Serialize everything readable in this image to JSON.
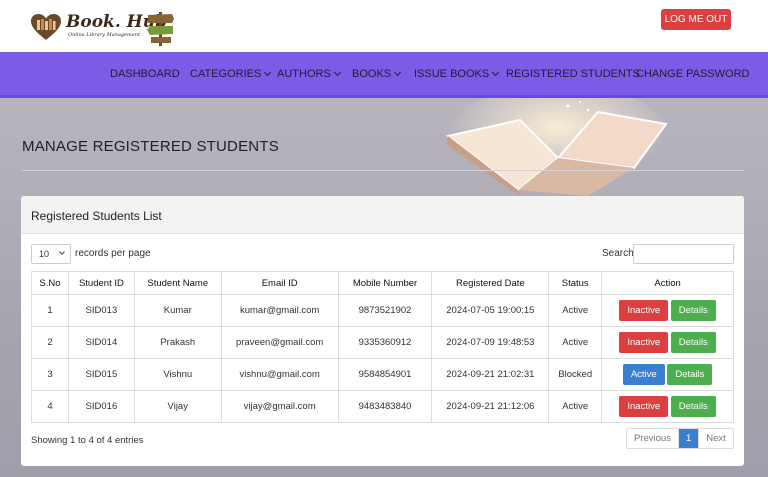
{
  "header": {
    "logo_text": "Book. Hub",
    "logo_subtext": "Online Library Management",
    "logout_label": "LOG ME OUT"
  },
  "nav": [
    {
      "label": "DASHBOARD",
      "dropdown": false
    },
    {
      "label": "CATEGORIES",
      "dropdown": true
    },
    {
      "label": "AUTHORS",
      "dropdown": true
    },
    {
      "label": "BOOKS",
      "dropdown": true
    },
    {
      "label": "ISSUE BOOKS",
      "dropdown": true
    },
    {
      "label": "REGISTERED STUDENTS",
      "dropdown": false
    },
    {
      "label": "CHANGE PASSWORD",
      "dropdown": false
    }
  ],
  "page": {
    "title": "MANAGE REGISTERED STUDENTS"
  },
  "card": {
    "title": "Registered Students List",
    "length_value": "10",
    "length_label": "records per page",
    "search_label": "Search:",
    "search_value": "",
    "columns": [
      "S.No",
      "Student ID",
      "Student Name",
      "Email ID",
      "Mobile Number",
      "Registered Date",
      "Status",
      "Action"
    ],
    "rows": [
      {
        "sno": "1",
        "id": "SID013",
        "name": "Kumar",
        "email": "kumar@gmail.com",
        "mobile": "9873521902",
        "date": "2024-07-05 19:00:15",
        "status": "Active",
        "toggle_label": "Inactive",
        "details_label": "Details"
      },
      {
        "sno": "2",
        "id": "SID014",
        "name": "Prakash",
        "email": "praveen@gmail.com",
        "mobile": "9335360912",
        "date": "2024-07-09 19:48:53",
        "status": "Active",
        "toggle_label": "Inactive",
        "details_label": "Details"
      },
      {
        "sno": "3",
        "id": "SID015",
        "name": "Vishnu",
        "email": "vishnu@gmail.com",
        "mobile": "9584854901",
        "date": "2024-09-21 21:02:31",
        "status": "Blocked",
        "toggle_label": "Active",
        "details_label": "Details"
      },
      {
        "sno": "4",
        "id": "SID016",
        "name": "Vijay",
        "email": "vijay@gmail.com",
        "mobile": "9483483840",
        "date": "2024-09-21 21:12:06",
        "status": "Active",
        "toggle_label": "Inactive",
        "details_label": "Details"
      }
    ],
    "info": "Showing 1 to 4 of 4 entries",
    "pager": {
      "prev": "Previous",
      "current": "1",
      "next": "Next"
    }
  },
  "colors": {
    "nav_bg": "#7c5ce6",
    "danger": "#dc3f3f",
    "primary": "#3b80d0",
    "success": "#4cae4c"
  }
}
